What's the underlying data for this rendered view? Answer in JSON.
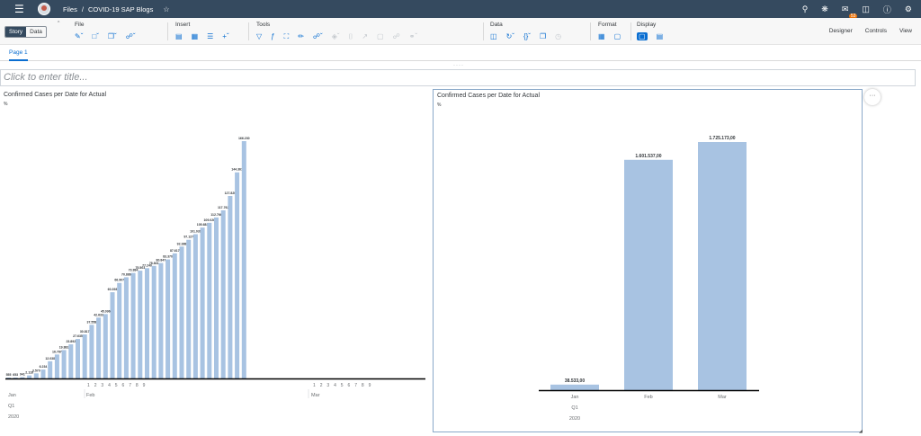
{
  "shell": {
    "menu_icon": "hamburger-icon",
    "breadcrumb_files": "Files",
    "breadcrumb_sep": "/",
    "breadcrumb_story": "COVID-19 SAP Blogs",
    "notification_count": "53"
  },
  "toolbar": {
    "mode_story": "Story",
    "mode_data": "Data",
    "groups": {
      "file": "File",
      "insert": "Insert",
      "tools": "Tools",
      "data": "Data",
      "format": "Format",
      "display": "Display"
    },
    "right": {
      "designer": "Designer",
      "controls": "Controls",
      "view": "View"
    }
  },
  "tabs": {
    "page1": "Page 1"
  },
  "title_placeholder": "Click to enter title...",
  "chart_data": [
    {
      "type": "bar",
      "title": "Confirmed Cases per Date for Actual",
      "subtitle": "%",
      "series": [
        {
          "values": [
            555,
            653,
            941,
            2118,
            3570,
            6234,
            12038,
            16787,
            19881,
            23892,
            27635,
            30817,
            37558,
            42633,
            45096,
            60393,
            66907,
            70886,
            73884,
            75503,
            77240,
            78841,
            80847,
            83370,
            87617,
            92388,
            97127,
            101039,
            105683,
            109026,
            112766,
            117762,
            127820,
            144361,
            166230
          ],
          "labels": [
            "555",
            "653",
            "941",
            "2.118",
            "3.570",
            "6.234",
            "12.038",
            "16.787",
            "19.881",
            "23.892",
            "27.635",
            "30.817",
            "37.558",
            "42.633",
            "45.096",
            "60.393",
            "66.907",
            "70.886",
            "73.884",
            "75.503",
            "77.240",
            "78.841",
            "80.847",
            "83.370",
            "87.617",
            "92.388",
            "97.127",
            "101.039",
            "105.683",
            "109.026",
            "112.766",
            "117.762",
            "127.820",
            "144.361",
            "166.230"
          ]
        }
      ],
      "axis_day_labels": [
        "1",
        "2",
        "3",
        "4",
        "5",
        "6",
        "7",
        "8",
        "9",
        "1",
        "2",
        "3",
        "4",
        "5",
        "6",
        "7",
        "8",
        "9"
      ],
      "axis_months": [
        "Jan",
        "Feb",
        "Mar"
      ],
      "axis_quarter": "Q1",
      "axis_year": "2020",
      "bar_color": "#a8c3e2"
    },
    {
      "type": "bar",
      "title": "Confirmed Cases per Date for Actual",
      "subtitle": "%",
      "categories": [
        "Jan",
        "Feb",
        "Mar"
      ],
      "values": [
        38533,
        1601537,
        1725173
      ],
      "labels": [
        "38.533,00",
        "1.601.537,00",
        "1.725.173,00"
      ],
      "axis_quarter": "Q1",
      "axis_year": "2020",
      "bar_color": "#a8c3e2"
    }
  ]
}
